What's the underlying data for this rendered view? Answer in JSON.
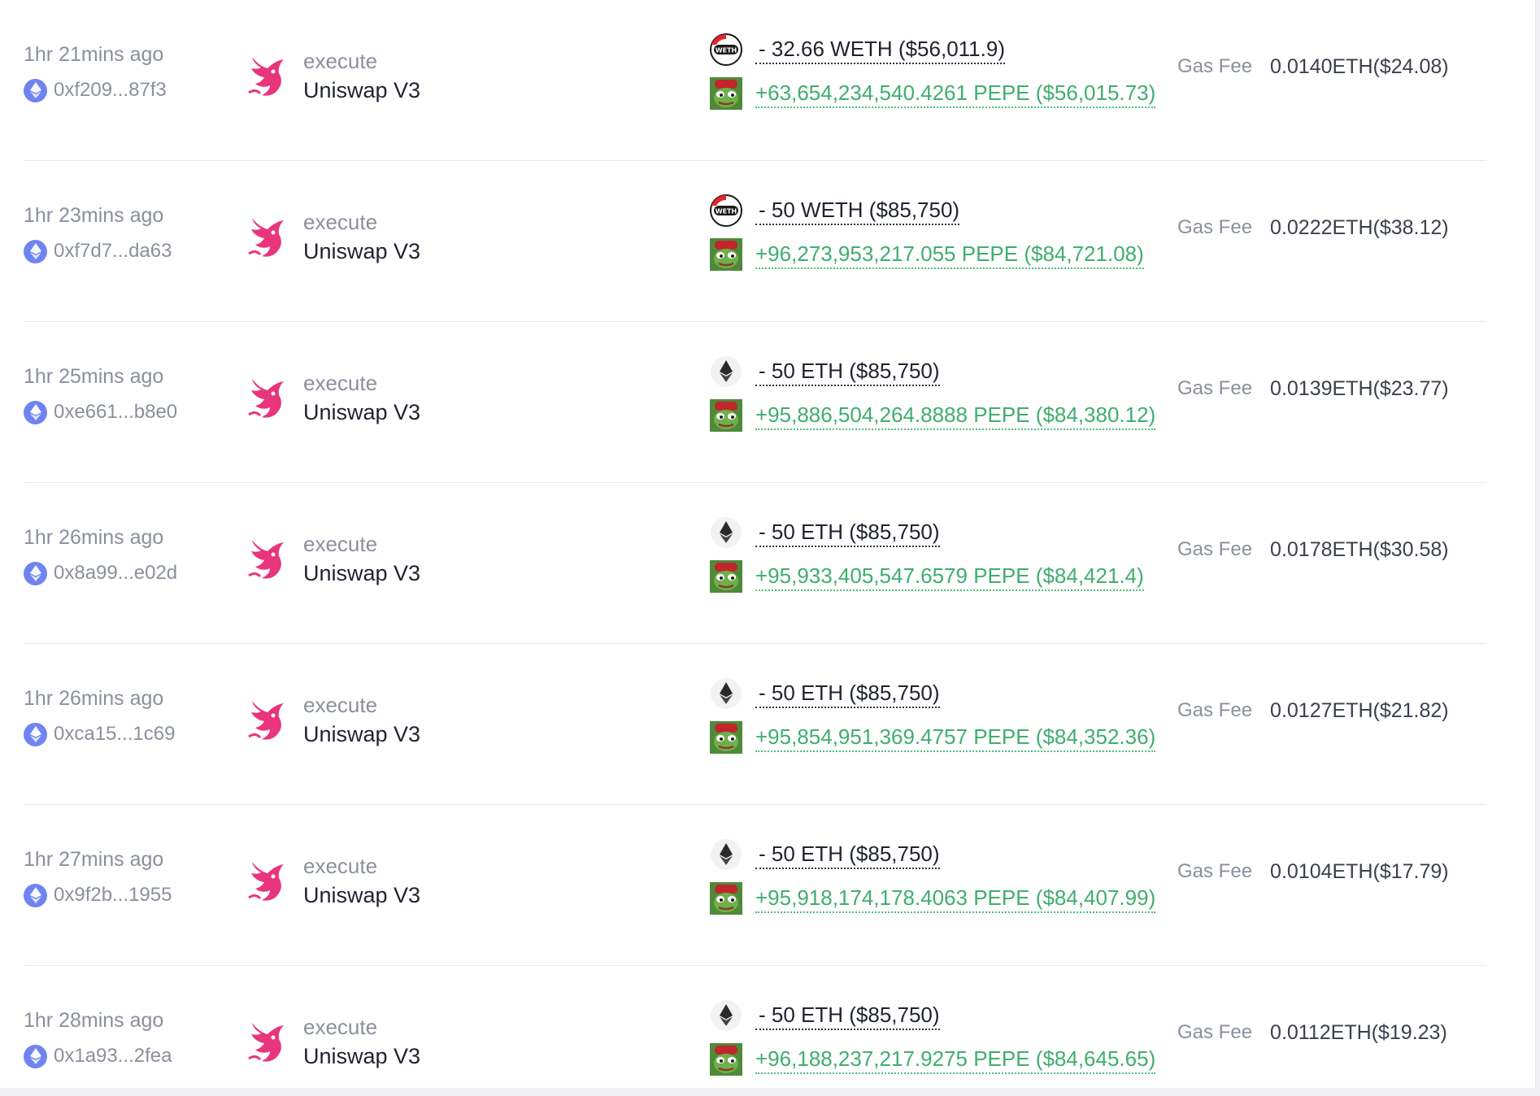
{
  "rows": [
    {
      "time": "1hr 21mins ago",
      "hash": "0xf209...87f3",
      "method": "execute",
      "protocol": "Uniswap V3",
      "out_icon": "weth-icon",
      "out": "- 32.66 WETH ($56,011.9)",
      "in": "+63,654,234,540.4261 PEPE ($56,015.73)",
      "gas_label": "Gas Fee",
      "gas": "0.0140ETH($24.08)"
    },
    {
      "time": "1hr 23mins ago",
      "hash": "0xf7d7...da63",
      "method": "execute",
      "protocol": "Uniswap V3",
      "out_icon": "weth-icon",
      "out": "- 50 WETH ($85,750)",
      "in": "+96,273,953,217.055 PEPE ($84,721.08)",
      "gas_label": "Gas Fee",
      "gas": "0.0222ETH($38.12)"
    },
    {
      "time": "1hr 25mins ago",
      "hash": "0xe661...b8e0",
      "method": "execute",
      "protocol": "Uniswap V3",
      "out_icon": "eth-icon",
      "out": "- 50 ETH ($85,750)",
      "in": "+95,886,504,264.8888 PEPE ($84,380.12)",
      "gas_label": "Gas Fee",
      "gas": "0.0139ETH($23.77)"
    },
    {
      "time": "1hr 26mins ago",
      "hash": "0x8a99...e02d",
      "method": "execute",
      "protocol": "Uniswap V3",
      "out_icon": "eth-icon",
      "out": "- 50 ETH ($85,750)",
      "in": "+95,933,405,547.6579 PEPE ($84,421.4)",
      "gas_label": "Gas Fee",
      "gas": "0.0178ETH($30.58)"
    },
    {
      "time": "1hr 26mins ago",
      "hash": "0xca15...1c69",
      "method": "execute",
      "protocol": "Uniswap V3",
      "out_icon": "eth-icon",
      "out": "- 50 ETH ($85,750)",
      "in": "+95,854,951,369.4757 PEPE ($84,352.36)",
      "gas_label": "Gas Fee",
      "gas": "0.0127ETH($21.82)"
    },
    {
      "time": "1hr 27mins ago",
      "hash": "0x9f2b...1955",
      "method": "execute",
      "protocol": "Uniswap V3",
      "out_icon": "eth-icon",
      "out": "- 50 ETH ($85,750)",
      "in": "+95,918,174,178.4063 PEPE ($84,407.99)",
      "gas_label": "Gas Fee",
      "gas": "0.0104ETH($17.79)"
    },
    {
      "time": "1hr 28mins ago",
      "hash": "0x1a93...2fea",
      "method": "execute",
      "protocol": "Uniswap V3",
      "out_icon": "eth-icon",
      "out": "- 50 ETH ($85,750)",
      "in": "+96,188,237,217.9275 PEPE ($84,645.65)",
      "gas_label": "Gas Fee",
      "gas": "0.0112ETH($19.23)"
    }
  ],
  "colors": {
    "muted": "#8a909c",
    "text": "#1f2330",
    "positive": "#3fae6f",
    "eth_badge": "#6f83f1",
    "uniswap_pink": "#e8357c"
  }
}
